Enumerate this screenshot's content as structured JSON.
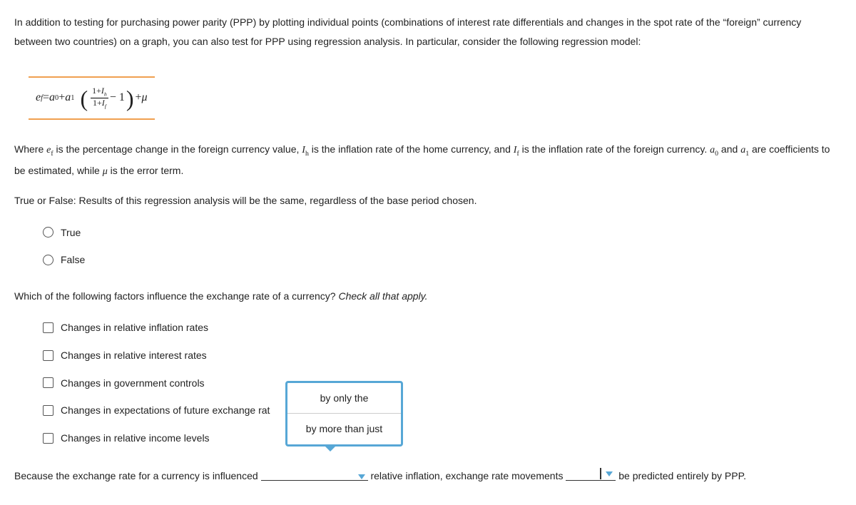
{
  "intro": {
    "p1": "In addition to testing for purchasing power parity (PPP) by plotting individual points (combinations of interest rate differentials and changes in the spot rate of the “foreign” currency between two countries) on a graph, you can also test for PPP using regression analysis. In particular, consider the following regression model:"
  },
  "where": {
    "prefix": "Where ",
    "ef_desc": " is the percentage change in the foreign currency value, ",
    "ih_desc": " is the inflation rate of the home currency, and ",
    "if_desc": " is the inflation rate of the foreign currency. ",
    "a0": "a",
    "a0_sub": "0",
    "and_word": " and ",
    "a1_sub": "1",
    "coef_desc": " are coefficients to be estimated, while ",
    "mu": "μ",
    "err_desc": " is the error term."
  },
  "q1": {
    "prompt": "True or False: Results of this regression analysis will be the same, regardless of the base period chosen.",
    "opt_true": "True",
    "opt_false": "False"
  },
  "q2": {
    "prompt_main": "Which of the following factors influence the exchange rate of a currency? ",
    "prompt_hint": "Check all that apply.",
    "opts": {
      "a": "Changes in relative inflation rates",
      "b": "Changes in relative interest rates",
      "c": "Changes in government controls",
      "d": "Changes in expectations of future exchange rat",
      "e": "Changes in relative income levels"
    }
  },
  "popup": {
    "item1": "by only the",
    "item2": "by more than just"
  },
  "fill": {
    "part1": "Because the exchange rate for a currency is influenced",
    "part2": "relative inflation, exchange rate movements",
    "part3": "be predicted entirely by PPP."
  },
  "formula": {
    "ef": "e",
    "ef_sub": "f",
    "eq": " = ",
    "a0": "a",
    "a0_sub": "0",
    "plus": " + ",
    "a1": "a",
    "a1_sub": "1",
    "num_1": "1+",
    "num_I": "I",
    "num_h": "h",
    "den_1": "1+",
    "den_I": "I",
    "den_f": "f",
    "minus1": " − 1",
    "plus2": " + ",
    "mu": "μ"
  }
}
